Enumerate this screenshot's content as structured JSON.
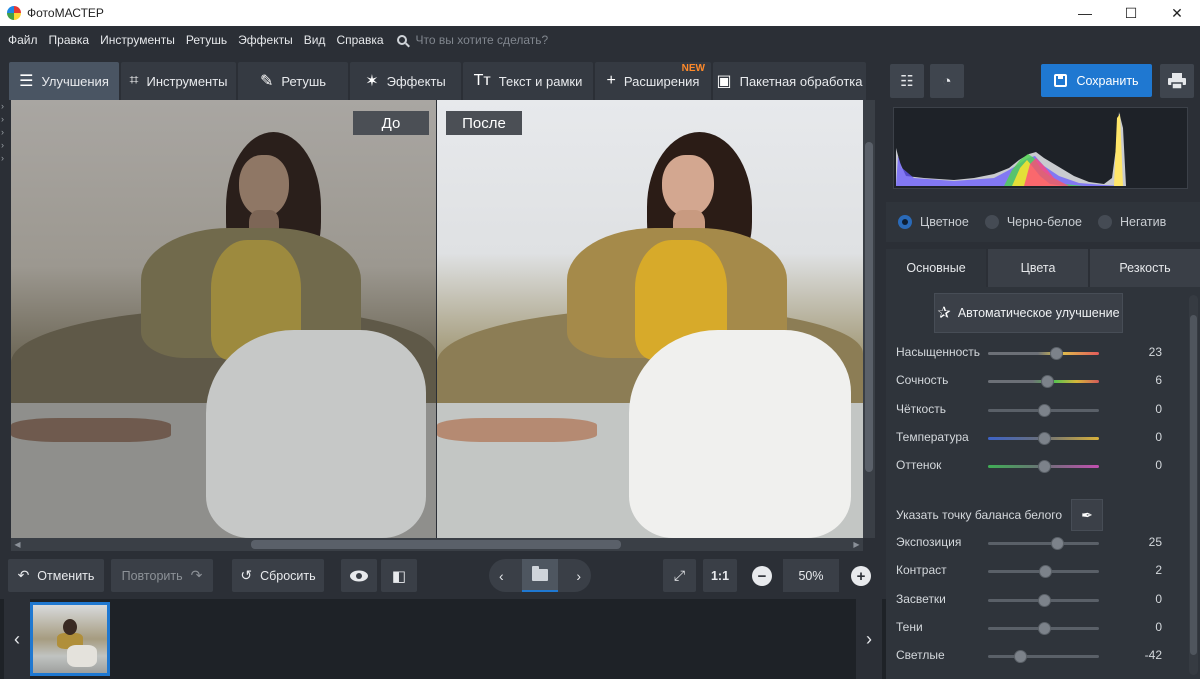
{
  "window": {
    "title": "ФотоМАСТЕР",
    "controls": [
      "—",
      "☐",
      "✕"
    ]
  },
  "menu": {
    "items": [
      "Файл",
      "Правка",
      "Инструменты",
      "Ретушь",
      "Эффекты",
      "Вид",
      "Справка"
    ],
    "search_placeholder": "Что вы хотите сделать?"
  },
  "toolbar": {
    "tabs": [
      {
        "label": "Улучшения",
        "icon": "sliders-icon",
        "active": true
      },
      {
        "label": "Инструменты",
        "icon": "crop-icon"
      },
      {
        "label": "Ретушь",
        "icon": "brush-icon"
      },
      {
        "label": "Эффекты",
        "icon": "magic-wand-icon"
      },
      {
        "label": "Текст и рамки",
        "icon": "text-icon"
      },
      {
        "label": "Расширения",
        "icon": "plus-icon",
        "badge": "NEW"
      },
      {
        "label": "Пакетная обработка",
        "icon": "images-icon"
      }
    ],
    "save_label": "Сохранить"
  },
  "compare": {
    "before": "До",
    "after": "После"
  },
  "actions": {
    "undo": "Отменить",
    "redo": "Повторить",
    "reset": "Сбросить",
    "fit": "1:1",
    "zoom": "50%"
  },
  "panel": {
    "modes": [
      {
        "label": "Цветное",
        "selected": true
      },
      {
        "label": "Черно-белое",
        "selected": false
      },
      {
        "label": "Негатив",
        "selected": false
      }
    ],
    "tabs": [
      {
        "label": "Основные",
        "active": true
      },
      {
        "label": "Цвета",
        "active": false
      },
      {
        "label": "Резкость",
        "active": false
      }
    ],
    "auto_button": "Автоматическое улучшение",
    "white_balance_label": "Указать точку баланса белого",
    "sliders_group1": [
      {
        "label": "Насыщенность",
        "value": 23,
        "min": -100,
        "max": 100,
        "track": "sat"
      },
      {
        "label": "Сочность",
        "value": 6,
        "min": -100,
        "max": 100,
        "track": "vib"
      },
      {
        "label": "Чёткость",
        "value": 0,
        "min": -100,
        "max": 100,
        "track": "gray"
      },
      {
        "label": "Температура",
        "value": 0,
        "min": -100,
        "max": 100,
        "track": "temp"
      },
      {
        "label": "Оттенок",
        "value": 0,
        "min": -100,
        "max": 100,
        "track": "tint"
      }
    ],
    "sliders_group2": [
      {
        "label": "Экспозиция",
        "value": 25,
        "min": -100,
        "max": 100
      },
      {
        "label": "Контраст",
        "value": 2,
        "min": -100,
        "max": 100
      },
      {
        "label": "Засветки",
        "value": 0,
        "min": -100,
        "max": 100
      },
      {
        "label": "Тени",
        "value": 0,
        "min": -100,
        "max": 100
      },
      {
        "label": "Светлые",
        "value": -42,
        "min": -100,
        "max": 100
      }
    ]
  },
  "colors": {
    "accent": "#1f78d1",
    "badge": "#ff8a2a",
    "active_tab": "#4a5563"
  }
}
